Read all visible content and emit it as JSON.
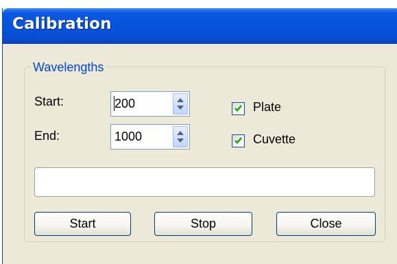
{
  "window": {
    "title": "Calibration"
  },
  "wavelengths": {
    "group_label": "Wavelengths",
    "start_label": "Start:",
    "start_value": "200",
    "end_label": "End:",
    "end_value": "1000"
  },
  "options": {
    "plate_label": "Plate",
    "plate_checked": true,
    "cuvette_label": "Cuvette",
    "cuvette_checked": true
  },
  "progress": {
    "value": 0
  },
  "buttons": {
    "start_label": "Start",
    "stop_label": "Stop",
    "close_label": "Close"
  },
  "colors": {
    "titlebar": "#0654da",
    "dialog_bg": "#ece9d8",
    "legend_text": "#0046d5",
    "checkmark": "#21a121"
  }
}
